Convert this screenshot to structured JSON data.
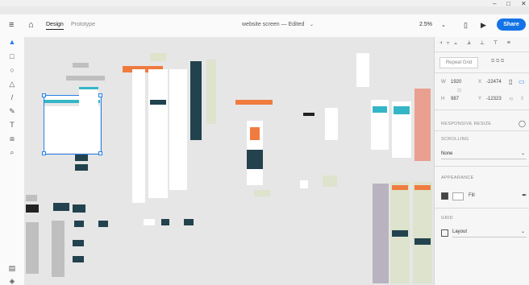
{
  "window": {
    "controls": {
      "minimize": "–",
      "maximize": "□",
      "close": "✕"
    }
  },
  "header": {
    "menu_icon": "hamburger-icon",
    "home_icon": "home-icon",
    "tabs": [
      {
        "label": "Design",
        "active": true
      },
      {
        "label": "Prototype",
        "active": false
      }
    ],
    "document_title": "website screen — Edited",
    "zoom": "2.5%",
    "share_label": "Share",
    "colors": {
      "accent": "#1473e6"
    }
  },
  "tools": [
    {
      "name": "select-tool",
      "glyph": "▲"
    },
    {
      "name": "rectangle-tool",
      "glyph": "□"
    },
    {
      "name": "ellipse-tool",
      "glyph": "○"
    },
    {
      "name": "polygon-tool",
      "glyph": "△"
    },
    {
      "name": "line-tool",
      "glyph": "/"
    },
    {
      "name": "pen-tool",
      "glyph": "✎"
    },
    {
      "name": "text-tool",
      "glyph": "T"
    },
    {
      "name": "artboard-tool",
      "glyph": "⧈"
    },
    {
      "name": "zoom-tool",
      "glyph": "⌕"
    }
  ],
  "bottom_tools": [
    {
      "name": "assets-icon",
      "glyph": "▤"
    },
    {
      "name": "layers-icon",
      "glyph": "◈"
    }
  ],
  "panel": {
    "repeat_grid_label": "Repeat Grid",
    "transform": {
      "w_label": "W",
      "w_value": "1920",
      "x_label": "X",
      "x_value": "-22474",
      "h_label": "H",
      "h_value": "987",
      "y_label": "Y",
      "y_value": "-12323"
    },
    "responsive_resize_label": "RESPONSIVE RESIZE",
    "scrolling_label": "SCROLLING",
    "scrolling_value": "None",
    "appearance_label": "APPEARANCE",
    "fill_label": "Fill",
    "fill_checked": true,
    "grid_label": "GRID",
    "grid_value": "Layout",
    "grid_checked": false
  }
}
